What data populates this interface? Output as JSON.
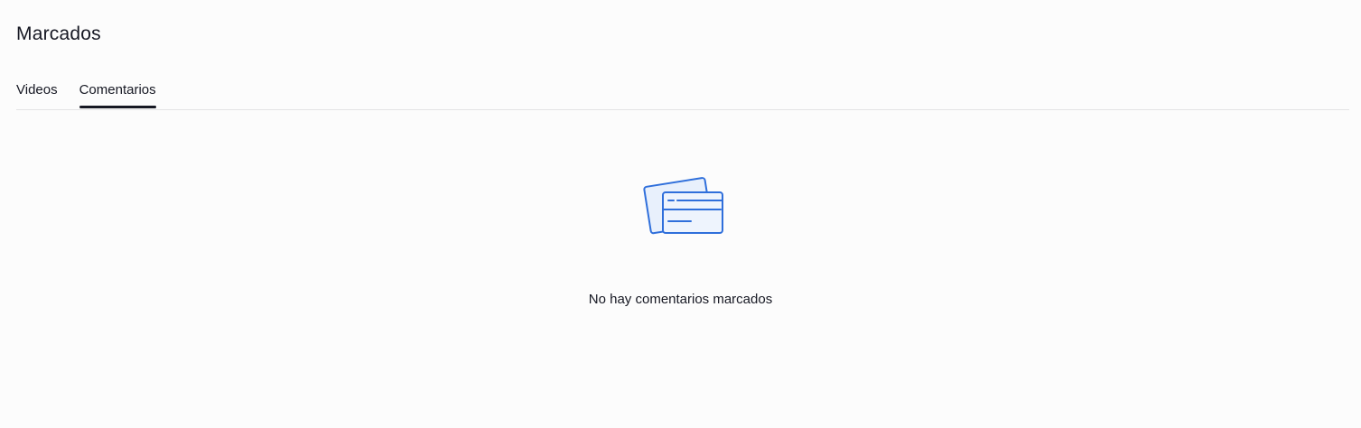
{
  "page": {
    "title": "Marcados"
  },
  "tabs": [
    {
      "label": "Videos",
      "active": false
    },
    {
      "label": "Comentarios",
      "active": true
    }
  ],
  "empty_state": {
    "icon": "bookmarked-cards-icon",
    "message": "No hay comentarios marcados",
    "accent_color": "#2f6fdb"
  }
}
